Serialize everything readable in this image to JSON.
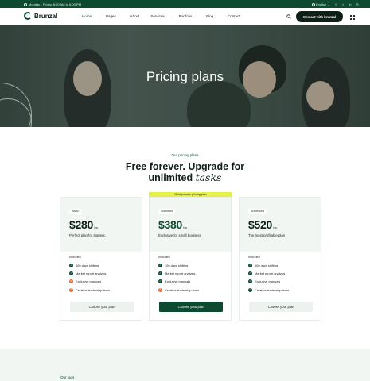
{
  "topbar": {
    "hours": "Monday - Friday, 8:00 AM to 6:00 PM",
    "language": "English",
    "social_icons": [
      "facebook-icon",
      "twitter-icon",
      "linkedin-icon",
      "instagram-icon"
    ]
  },
  "nav": {
    "logo": "Brunzal",
    "items": [
      {
        "label": "Home",
        "has_dropdown": true
      },
      {
        "label": "Pages",
        "has_dropdown": true
      },
      {
        "label": "About",
        "has_dropdown": false
      },
      {
        "label": "Services",
        "has_dropdown": true
      },
      {
        "label": "Portfolio",
        "has_dropdown": true
      },
      {
        "label": "Blog",
        "has_dropdown": true
      },
      {
        "label": "Contact",
        "has_dropdown": false
      }
    ],
    "cta": "Contact with brunzal"
  },
  "hero": {
    "title": "Pricing plans"
  },
  "pricing": {
    "eyebrow": "Our pricing plans",
    "title_line1": "Free forever. Upgrade for",
    "title_line2": "unlimited",
    "title_emphasis": "tasks",
    "popular_label": "Most popular pricing plan",
    "cards": [
      {
        "tag": "Basic",
        "price": "$280",
        "per": "/mo",
        "desc": "Perfect plan for starters.",
        "includes": "Includes",
        "features": [
          {
            "text": "100 days shifting",
            "ok": true
          },
          {
            "text": "Market report analysis",
            "ok": true
          },
          {
            "text": "Exclusive manuals",
            "ok": false
          },
          {
            "text": "Creative leadership team",
            "ok": false
          }
        ],
        "button": "Choose your plan"
      },
      {
        "tag": "Standard",
        "price": "$380",
        "per": "/mo",
        "desc": "Exclusive for small business",
        "includes": "Includes",
        "features": [
          {
            "text": "100 days shifting",
            "ok": true
          },
          {
            "text": "Market report analysis",
            "ok": true
          },
          {
            "text": "Exclusive manuals",
            "ok": true
          },
          {
            "text": "Creative leadership team",
            "ok": false
          }
        ],
        "button": "Choose your plan"
      },
      {
        "tag": "Advanced",
        "price": "$520",
        "per": "/mo",
        "desc": "The most profitable plan",
        "includes": "Includes",
        "features": [
          {
            "text": "100 days shifting",
            "ok": true
          },
          {
            "text": "Market report analysis",
            "ok": true
          },
          {
            "text": "Exclusive manuals",
            "ok": true
          },
          {
            "text": "Creative leadership team",
            "ok": true
          }
        ],
        "button": "Choose your plan"
      }
    ]
  },
  "faq": {
    "eyebrow": "Our faqs"
  },
  "colors": {
    "brand_green": "#0d4a2f",
    "accent_yellow": "#e6f04b",
    "cross_orange": "#f06a2a"
  }
}
